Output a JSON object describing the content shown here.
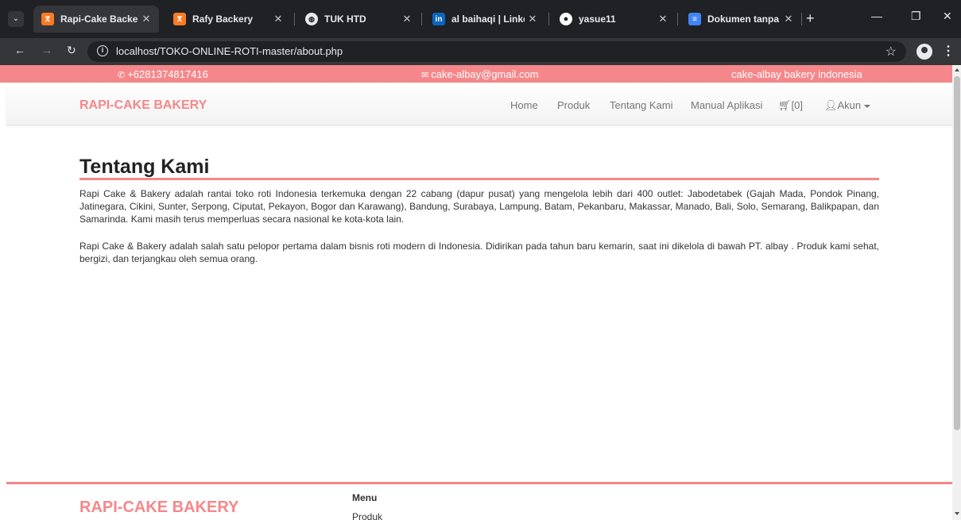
{
  "browser": {
    "tabs": [
      {
        "title": "Rapi-Cake Backery",
        "icon": "xampp-icon",
        "color": "#fb7a24"
      },
      {
        "title": "Rafy Backery",
        "icon": "xampp-icon",
        "color": "#fb7a24"
      },
      {
        "title": "TUK HTD",
        "icon": "globe-icon",
        "color": "#e8eaed"
      },
      {
        "title": "al baihaqi | LinkedIn",
        "icon": "linkedin-icon",
        "color": "#0a66c2"
      },
      {
        "title": "yasue11",
        "icon": "github-icon",
        "color": "#ffffff"
      },
      {
        "title": "Dokumen tanpa judul",
        "icon": "google-docs-icon",
        "color": "#4285f4"
      }
    ],
    "address": "localhost/TOKO-ONLINE-ROTI-master/about.php"
  },
  "site": {
    "accent_color": "#f5878a",
    "topbar": {
      "phone": "+6281374817416",
      "email": "cake-albay@gmail.com",
      "tagline": "cake-albay bakery indonesia"
    },
    "brand": "RAPI-CAKE BAKERY",
    "nav": {
      "home": "Home",
      "produk": "Produk",
      "tentang": "Tentang Kami",
      "manual": "Manual Aplikasi",
      "cart": "[0]",
      "akun": "Akun"
    },
    "content": {
      "title": "Tentang Kami",
      "paragraph1": "Rapi Cake & Bakery adalah rantai toko roti Indonesia terkemuka dengan 22 cabang (dapur pusat) yang mengelola lebih dari 400 outlet: Jabodetabek (Gajah Mada, Pondok Pinang, Jatinegara, Cikini, Sunter, Serpong, Ciputat, Pekayon, Bogor dan Karawang), Bandung, Surabaya, Lampung, Batam, Pekanbaru, Makassar, Manado, Bali, Solo, Semarang, Balikpapan, dan Samarinda. Kami masih terus memperluas secara nasional ke kota-kota lain.",
      "paragraph2": "Rapi Cake & Bakery adalah salah satu pelopor pertama dalam bisnis roti modern di Indonesia. Didirikan pada tahun baru kemarin, saat ini dikelola di bawah PT. albay . Produk kami sehat, bergizi, dan terjangkau oleh semua orang."
    },
    "footer": {
      "brand": "RAPI-CAKE BAKERY",
      "menu_title": "Menu",
      "menu_item": "Produk"
    }
  }
}
